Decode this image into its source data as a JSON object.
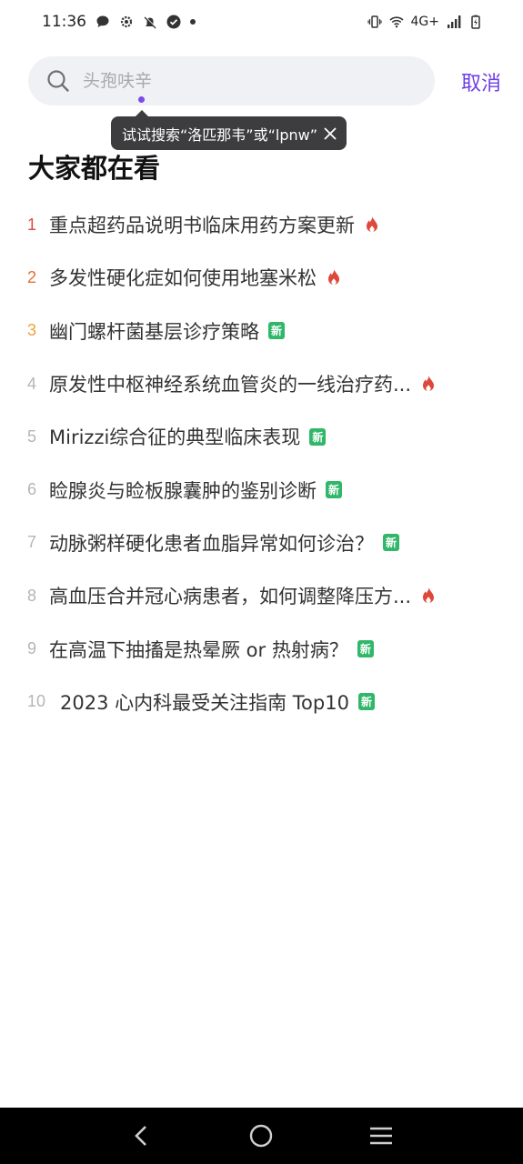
{
  "status_bar": {
    "time": "11:36",
    "network": "4G+"
  },
  "search": {
    "placeholder": "头孢呋辛",
    "cancel_label": "取消",
    "tooltip": "试试搜索“洛匹那韦”或“lpnw”"
  },
  "section_title": "大家都在看",
  "trending": [
    {
      "rank": "1",
      "text": "重点超药品说明书临床用药方案更新",
      "tag": "hot"
    },
    {
      "rank": "2",
      "text": "多发性硬化症如何使用地塞米松",
      "tag": "hot"
    },
    {
      "rank": "3",
      "text": "幽门螺杆菌基层诊疗策略",
      "tag": "new"
    },
    {
      "rank": "4",
      "text": "原发性中枢神经系统血管炎的一线治疗药...",
      "tag": "hot"
    },
    {
      "rank": "5",
      "text": "Mirizzi综合征的典型临床表现",
      "tag": "new"
    },
    {
      "rank": "6",
      "text": "睑腺炎与睑板腺囊肿的鉴别诊断",
      "tag": "new"
    },
    {
      "rank": "7",
      "text": "动脉粥样硬化患者血脂异常如何诊治？",
      "tag": "new"
    },
    {
      "rank": "8",
      "text": "高血压合并冠心病患者，如何调整降压方...",
      "tag": "hot"
    },
    {
      "rank": "9",
      "text": "在高温下抽搐是热晕厥 or 热射病？",
      "tag": "new"
    },
    {
      "rank": "10",
      "text": "2023 心内科最受关注指南 Top10",
      "tag": "new"
    }
  ],
  "badge_new_label": "新",
  "colors": {
    "accent": "#6d3ee6",
    "hot": "#e0473b",
    "new_badge": "#31b76a"
  }
}
